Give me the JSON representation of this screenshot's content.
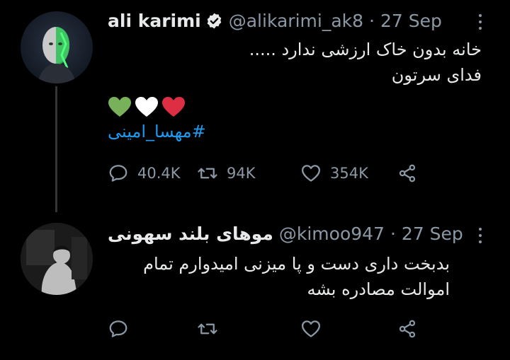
{
  "tweets": [
    {
      "author_name": "ali karimi",
      "handle": "@alikarimi_ak8",
      "separator": "·",
      "date": "27 Sep",
      "verified": true,
      "body_lines": [
        "خانه بدون خاک ارزشی ندارد .....",
        "فدای سرتون"
      ],
      "hearts": [
        "green",
        "white",
        "red"
      ],
      "hashtag": "#مهسا_امینی",
      "actions": {
        "reply_count": "40.4K",
        "retweet_count": "94K",
        "like_count": "354K"
      }
    },
    {
      "author_name": "موهای بلند سهونی",
      "handle": "@kimoo947",
      "separator": "·",
      "date": "27 Sep",
      "verified": false,
      "body_lines": [
        "بدبخت داری دست و پا میزنی امیدوارم تمام",
        "اموالت مصادره بشه"
      ]
    }
  ],
  "colors": {
    "background": "#000000",
    "text": "#e7e9ea",
    "muted": "#8b98a5",
    "hashtag": "#1d9bf0",
    "verified": "#e7e9ea",
    "heart_green": "#78b159",
    "heart_white": "#ffffff",
    "heart_red": "#dd2e44"
  },
  "icons": [
    "more-icon",
    "verified-icon",
    "reply-icon",
    "retweet-icon",
    "like-icon",
    "share-icon"
  ]
}
